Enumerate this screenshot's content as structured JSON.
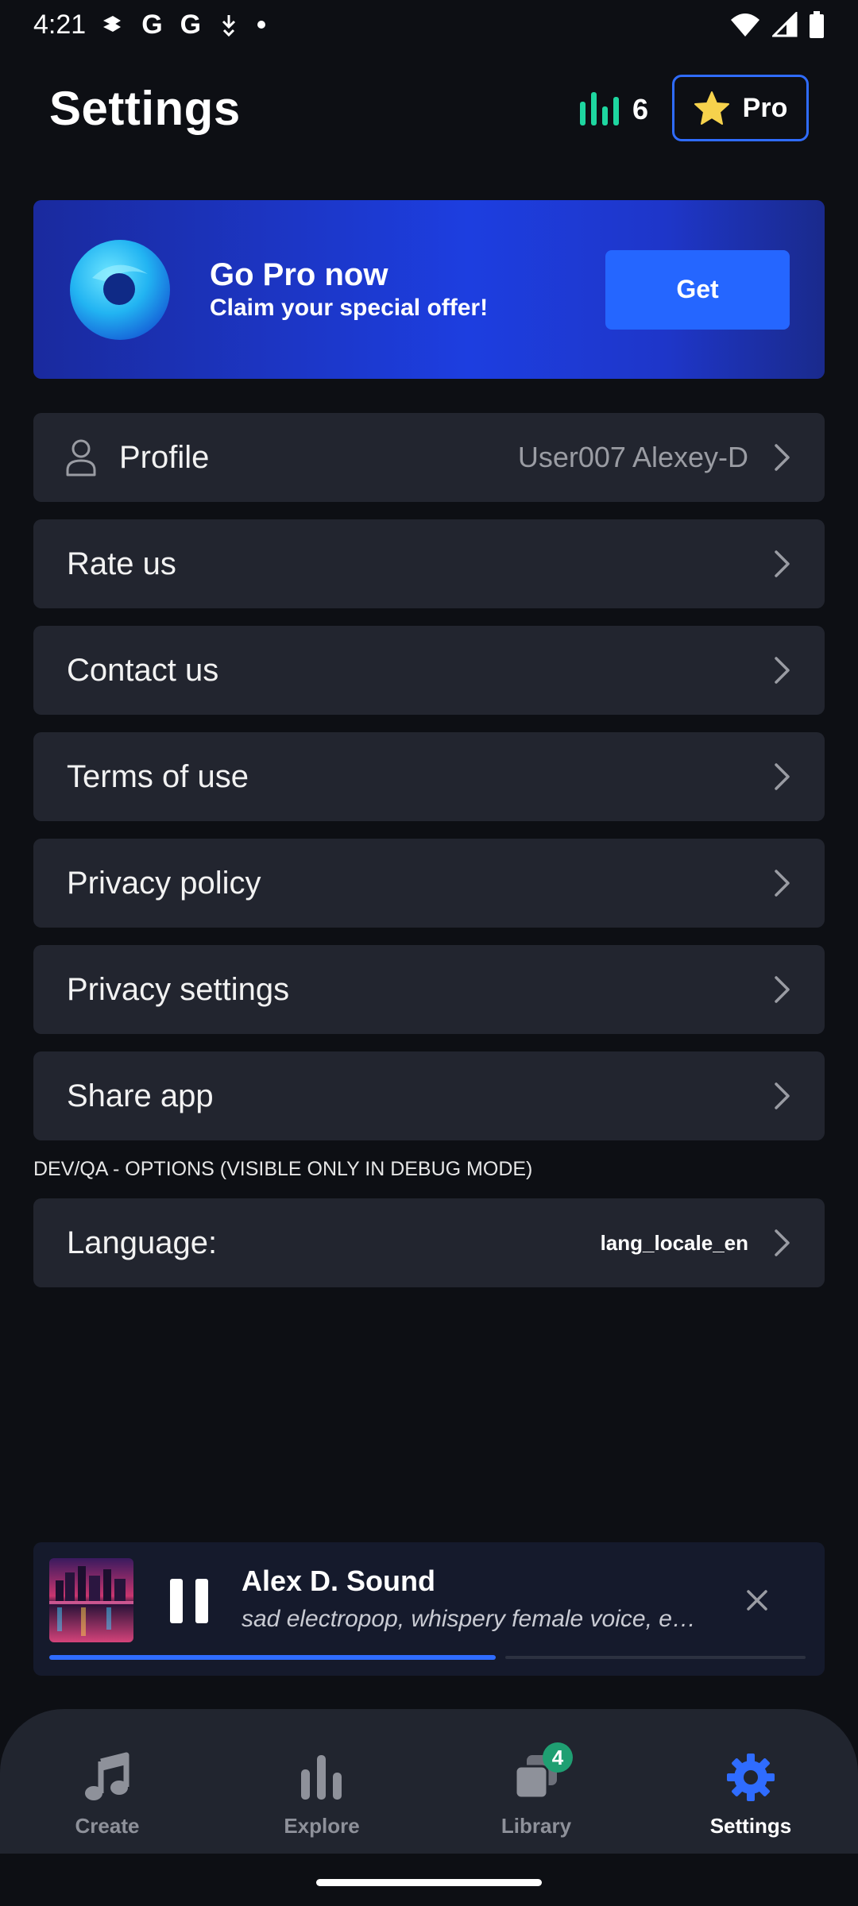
{
  "status_bar": {
    "time": "4:21",
    "notification_icons": [
      "G",
      "G"
    ]
  },
  "header": {
    "title": "Settings",
    "credits": "6",
    "pro_label": "Pro"
  },
  "promo": {
    "title": "Go Pro now",
    "subtitle": "Claim your special offer!",
    "button": "Get"
  },
  "menu": {
    "profile": {
      "label": "Profile",
      "value": "User007 Alexey-D"
    },
    "rate": "Rate us",
    "contact": "Contact us",
    "terms": "Terms of use",
    "privacy_policy": "Privacy policy",
    "privacy_settings": "Privacy settings",
    "share": "Share app"
  },
  "debug": {
    "label": "DEV/QA - OPTIONS (VISIBLE ONLY IN DEBUG MODE)",
    "language_label": "Language:",
    "language_value": "lang_locale_en"
  },
  "player": {
    "title": "Alex D. Sound",
    "subtitle": "sad electropop, whispery female voice, ee…",
    "progress": 0.59
  },
  "nav": {
    "create": "Create",
    "explore": "Explore",
    "library": "Library",
    "library_badge": "4",
    "settings": "Settings"
  },
  "colors": {
    "accent": "#2f6cff",
    "background": "#0d0f14",
    "row": "#22252f",
    "credits_green": "#1ed6a0",
    "badge_green": "#1f9f72"
  }
}
